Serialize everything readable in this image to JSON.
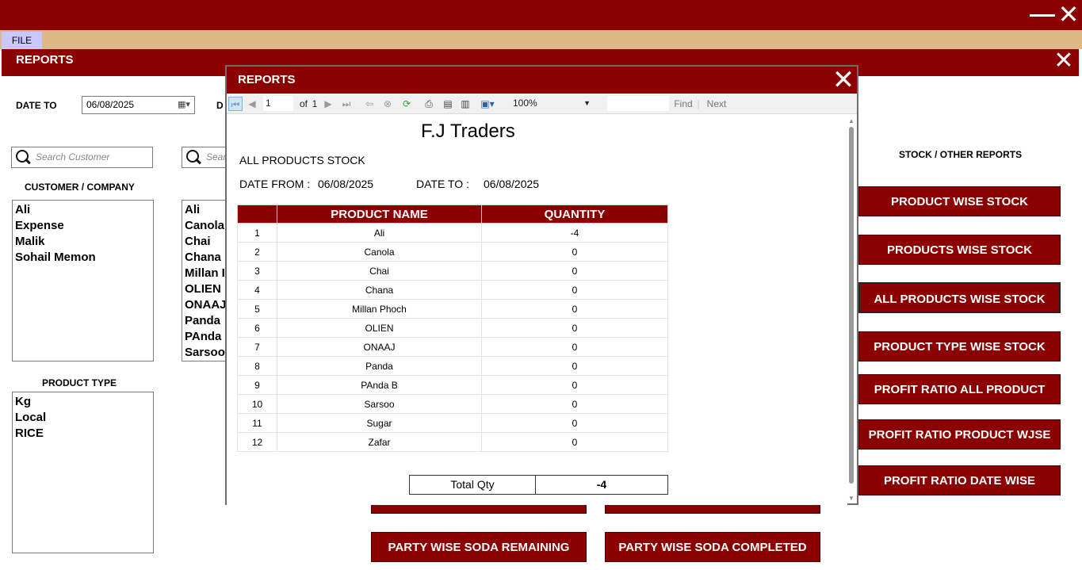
{
  "window": {
    "minimize_label": "—",
    "close_label": "✕"
  },
  "menu": {
    "file_label": "FILE"
  },
  "reports_bar": {
    "title": "REPORTS"
  },
  "form": {
    "date_to_label": "DATE TO",
    "date_to_value": "06/08/2025",
    "date_from_label": "D",
    "customer_search_placeholder": "Search Customer",
    "product_search_placeholder": "Sear",
    "customer_label": "CUSTOMER / COMPANY",
    "product_type_label": "PRODUCT TYPE",
    "customers": [
      "Ali",
      "Expense",
      "Malik",
      "Sohail Memon"
    ],
    "products": [
      "Ali",
      "Canola",
      "Chai",
      "Chana",
      "Millan I",
      "OLIEN",
      "ONAAJ",
      "Panda",
      "PAnda",
      "Sarsoo"
    ],
    "product_types": [
      "Kg",
      "Local",
      "RICE"
    ]
  },
  "stock_reports": {
    "heading": "STOCK / OTHER REPORTS",
    "buttons": [
      "PRODUCT WISE STOCK",
      "PRODUCTS WISE STOCK",
      "ALL PRODUCTS WISE STOCK",
      "PRODUCT TYPE WISE STOCK",
      "PROFIT RATIO ALL PRODUCT",
      "PROFIT RATIO PRODUCT WJSE",
      "PROFIT RATIO DATE WISE"
    ]
  },
  "party_buttons": {
    "remaining": "PARTY WISE SODA REMAINING",
    "completed": "PARTY WISE SODA COMPLETED"
  },
  "dialog": {
    "title": "REPORTS",
    "close_label": "✕",
    "toolbar": {
      "page_value": "1",
      "of_label": "of",
      "total_pages": "1",
      "zoom": "100%",
      "find_label": "Find",
      "next_label": "Next"
    },
    "report": {
      "company": "F.J Traders",
      "title": "ALL PRODUCTS STOCK",
      "date_from_label": "DATE FROM :",
      "date_from": "06/08/2025",
      "date_to_label": "DATE TO :",
      "date_to": "06/08/2025",
      "columns": [
        "",
        "PRODUCT NAME",
        "QUANTITY"
      ],
      "rows": [
        [
          "1",
          "Ali",
          "-4"
        ],
        [
          "2",
          "Canola",
          "0"
        ],
        [
          "3",
          "Chai",
          "0"
        ],
        [
          "4",
          "Chana",
          "0"
        ],
        [
          "5",
          "Millan Phoch",
          "0"
        ],
        [
          "6",
          "OLIEN",
          "0"
        ],
        [
          "7",
          "ONAAJ",
          "0"
        ],
        [
          "8",
          "Panda",
          "0"
        ],
        [
          "9",
          "PAnda B",
          "0"
        ],
        [
          "10",
          "Sarsoo",
          "0"
        ],
        [
          "11",
          "Sugar",
          "0"
        ],
        [
          "12",
          "Zafar",
          "0"
        ]
      ],
      "total_label": "Total Qty",
      "total_value": "-4"
    }
  }
}
